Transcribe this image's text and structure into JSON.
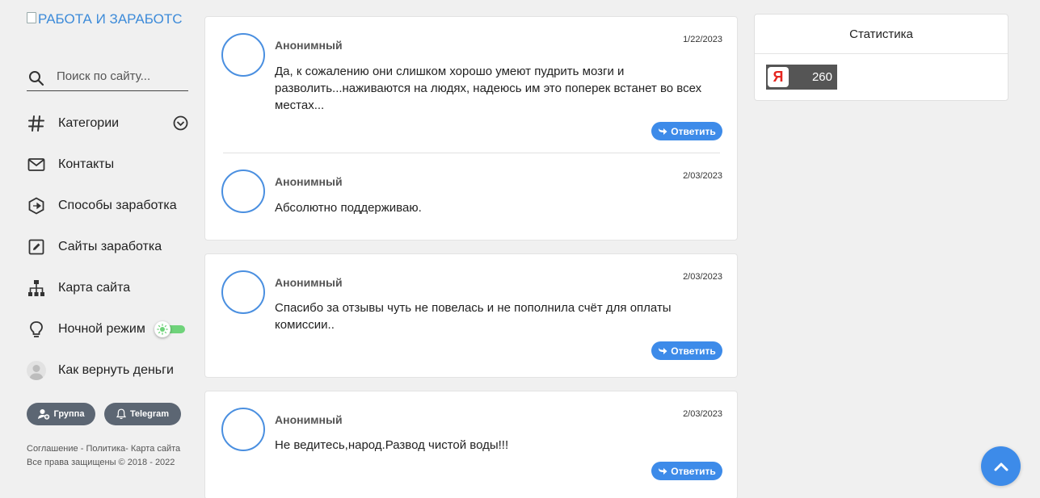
{
  "site": {
    "logo_alt": "РАБОТА И ЗАРАБОТС"
  },
  "search": {
    "placeholder": "Поиск по сайту..."
  },
  "nav": [
    {
      "label": "Категории",
      "icon": "hash-icon"
    },
    {
      "label": "Контакты",
      "icon": "mail-icon"
    },
    {
      "label": "Способы заработка",
      "icon": "hexagon-arrow-icon"
    },
    {
      "label": "Сайты заработка",
      "icon": "edit-icon"
    },
    {
      "label": "Карта сайта",
      "icon": "sitemap-icon"
    },
    {
      "label": "Ночной режим",
      "icon": "lightbulb-icon"
    },
    {
      "label": "Как вернуть деньги",
      "icon": "user-avatar-icon"
    }
  ],
  "social": {
    "group_label": "Группа",
    "telegram_label": "Telegram"
  },
  "footer": {
    "agreement": "Соглашение",
    "sep1": " - ",
    "policy": "Политика",
    "sep2": "- ",
    "sitemap": "Карта сайта",
    "copyright": "Все права защищены © 2018 - 2022"
  },
  "comments": [
    {
      "author": "Анонимный",
      "date": "1/22/2023",
      "text": "Да, к сожалению они слишком хорошо умеют пудрить мозги и разволить...наживаются на людях, надеюсь им это поперек встанет во всех местах...",
      "reply_label": "Ответить"
    },
    {
      "author": "Анонимный",
      "date": "2/03/2023",
      "text": "Абсолютно поддерживаю."
    },
    {
      "author": "Анонимный",
      "date": "2/03/2023",
      "text": "Спасибо за отзывы чуть не повелась и не пополнила счёт для оплаты комиссии..",
      "reply_label": "Ответить"
    },
    {
      "author": "Анонимный",
      "date": "2/03/2023",
      "text": "Не ведитесь,народ.Развод чистой воды!!!",
      "reply_label": "Ответить"
    }
  ],
  "stats": {
    "title": "Статистика",
    "counter_logo": "Я",
    "counter_value": "260"
  },
  "colors": {
    "accent": "#3d8be9",
    "toggle_on": "#6fd37a",
    "pill_bg": "#5c6673"
  }
}
